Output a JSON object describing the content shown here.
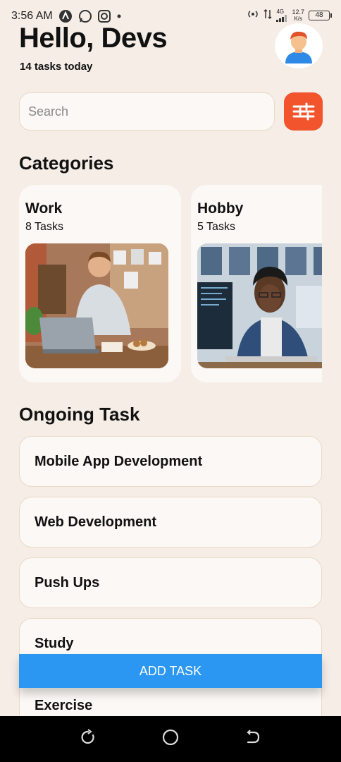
{
  "status_bar": {
    "time": "3:56 AM",
    "speed": "12.7",
    "speed_unit": "K/s",
    "network": "4G",
    "battery": "48"
  },
  "header": {
    "greeting": "Hello, Devs",
    "subtitle": "14 tasks today"
  },
  "search": {
    "placeholder": "Search"
  },
  "categories": {
    "title": "Categories",
    "items": [
      {
        "name": "Work",
        "count": "8 Tasks"
      },
      {
        "name": "Hobby",
        "count": "5 Tasks"
      }
    ]
  },
  "ongoing": {
    "title": "Ongoing Task",
    "tasks": [
      "Mobile App Development",
      "Web Development",
      "Push Ups",
      "Study",
      "Exercise"
    ]
  },
  "add_button": {
    "label": "ADD TASK"
  },
  "colors": {
    "background": "#f5ede6",
    "accent_orange": "#f2542d",
    "button_blue": "#2b97f2",
    "card": "#fbf8f5",
    "border": "#ead9c6"
  },
  "icons": [
    "signal-icon",
    "whatsapp-icon",
    "instagram-icon",
    "filter-icon",
    "avatar-icon",
    "recent-apps-icon",
    "home-icon",
    "back-icon"
  ]
}
